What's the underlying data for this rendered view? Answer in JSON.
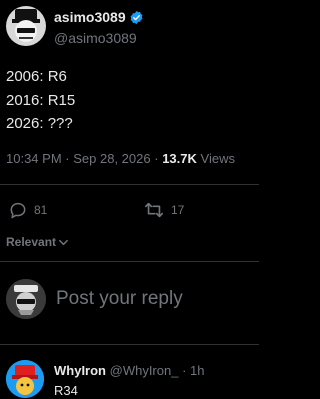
{
  "post": {
    "author_name": "asimo3089",
    "author_handle": "@asimo3089",
    "text_lines": [
      "2006: R6",
      "2016: R15",
      "2026: ???"
    ],
    "time": "10:34 PM",
    "separator": "·",
    "date": "Sep 28, 2026",
    "separator2": "·",
    "views_count": "13.7K",
    "views_label": "Views",
    "reply_count": "81",
    "repost_count": "17"
  },
  "sort": {
    "label": "Relevant"
  },
  "composer": {
    "placeholder": "Post your reply"
  },
  "reply": {
    "author_name": "WhyIron",
    "author_handle": "@WhyIron_",
    "dot": "·",
    "time": "1h",
    "text": "R34"
  },
  "colors": {
    "background": "#000000",
    "text_primary": "#e7e9ea",
    "text_secondary": "#71767b",
    "divider": "#2f3336",
    "verified": "#1d9bf0"
  },
  "icons": {
    "verified": "verified-badge-icon",
    "reply": "reply-bubble-icon",
    "repost": "repost-arrows-icon",
    "sort": "chevron-down-icon"
  }
}
